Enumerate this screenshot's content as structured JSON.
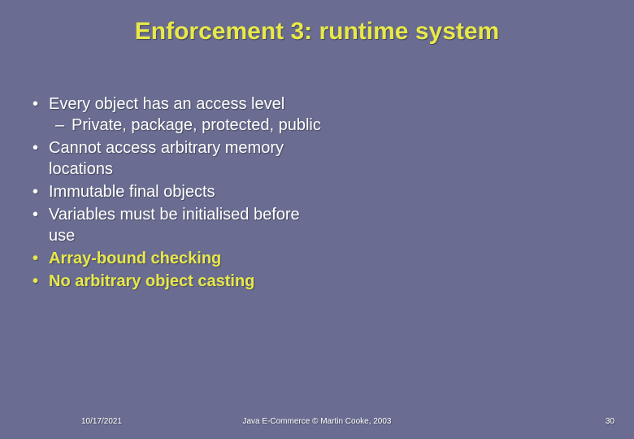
{
  "title": "Enforcement 3: runtime system",
  "bullets": {
    "b1": "Every object has an access level",
    "b1a": "Private, package, protected, public",
    "b2": "Cannot access arbitrary memory locations",
    "b3": "Immutable final objects",
    "b4": "Variables must be initialised before use",
    "b5": "Array-bound checking",
    "b6": "No arbitrary object casting"
  },
  "footer": {
    "date": "10/17/2021",
    "center": "Java E-Commerce © Martin Cooke, 2003",
    "page": "30"
  }
}
